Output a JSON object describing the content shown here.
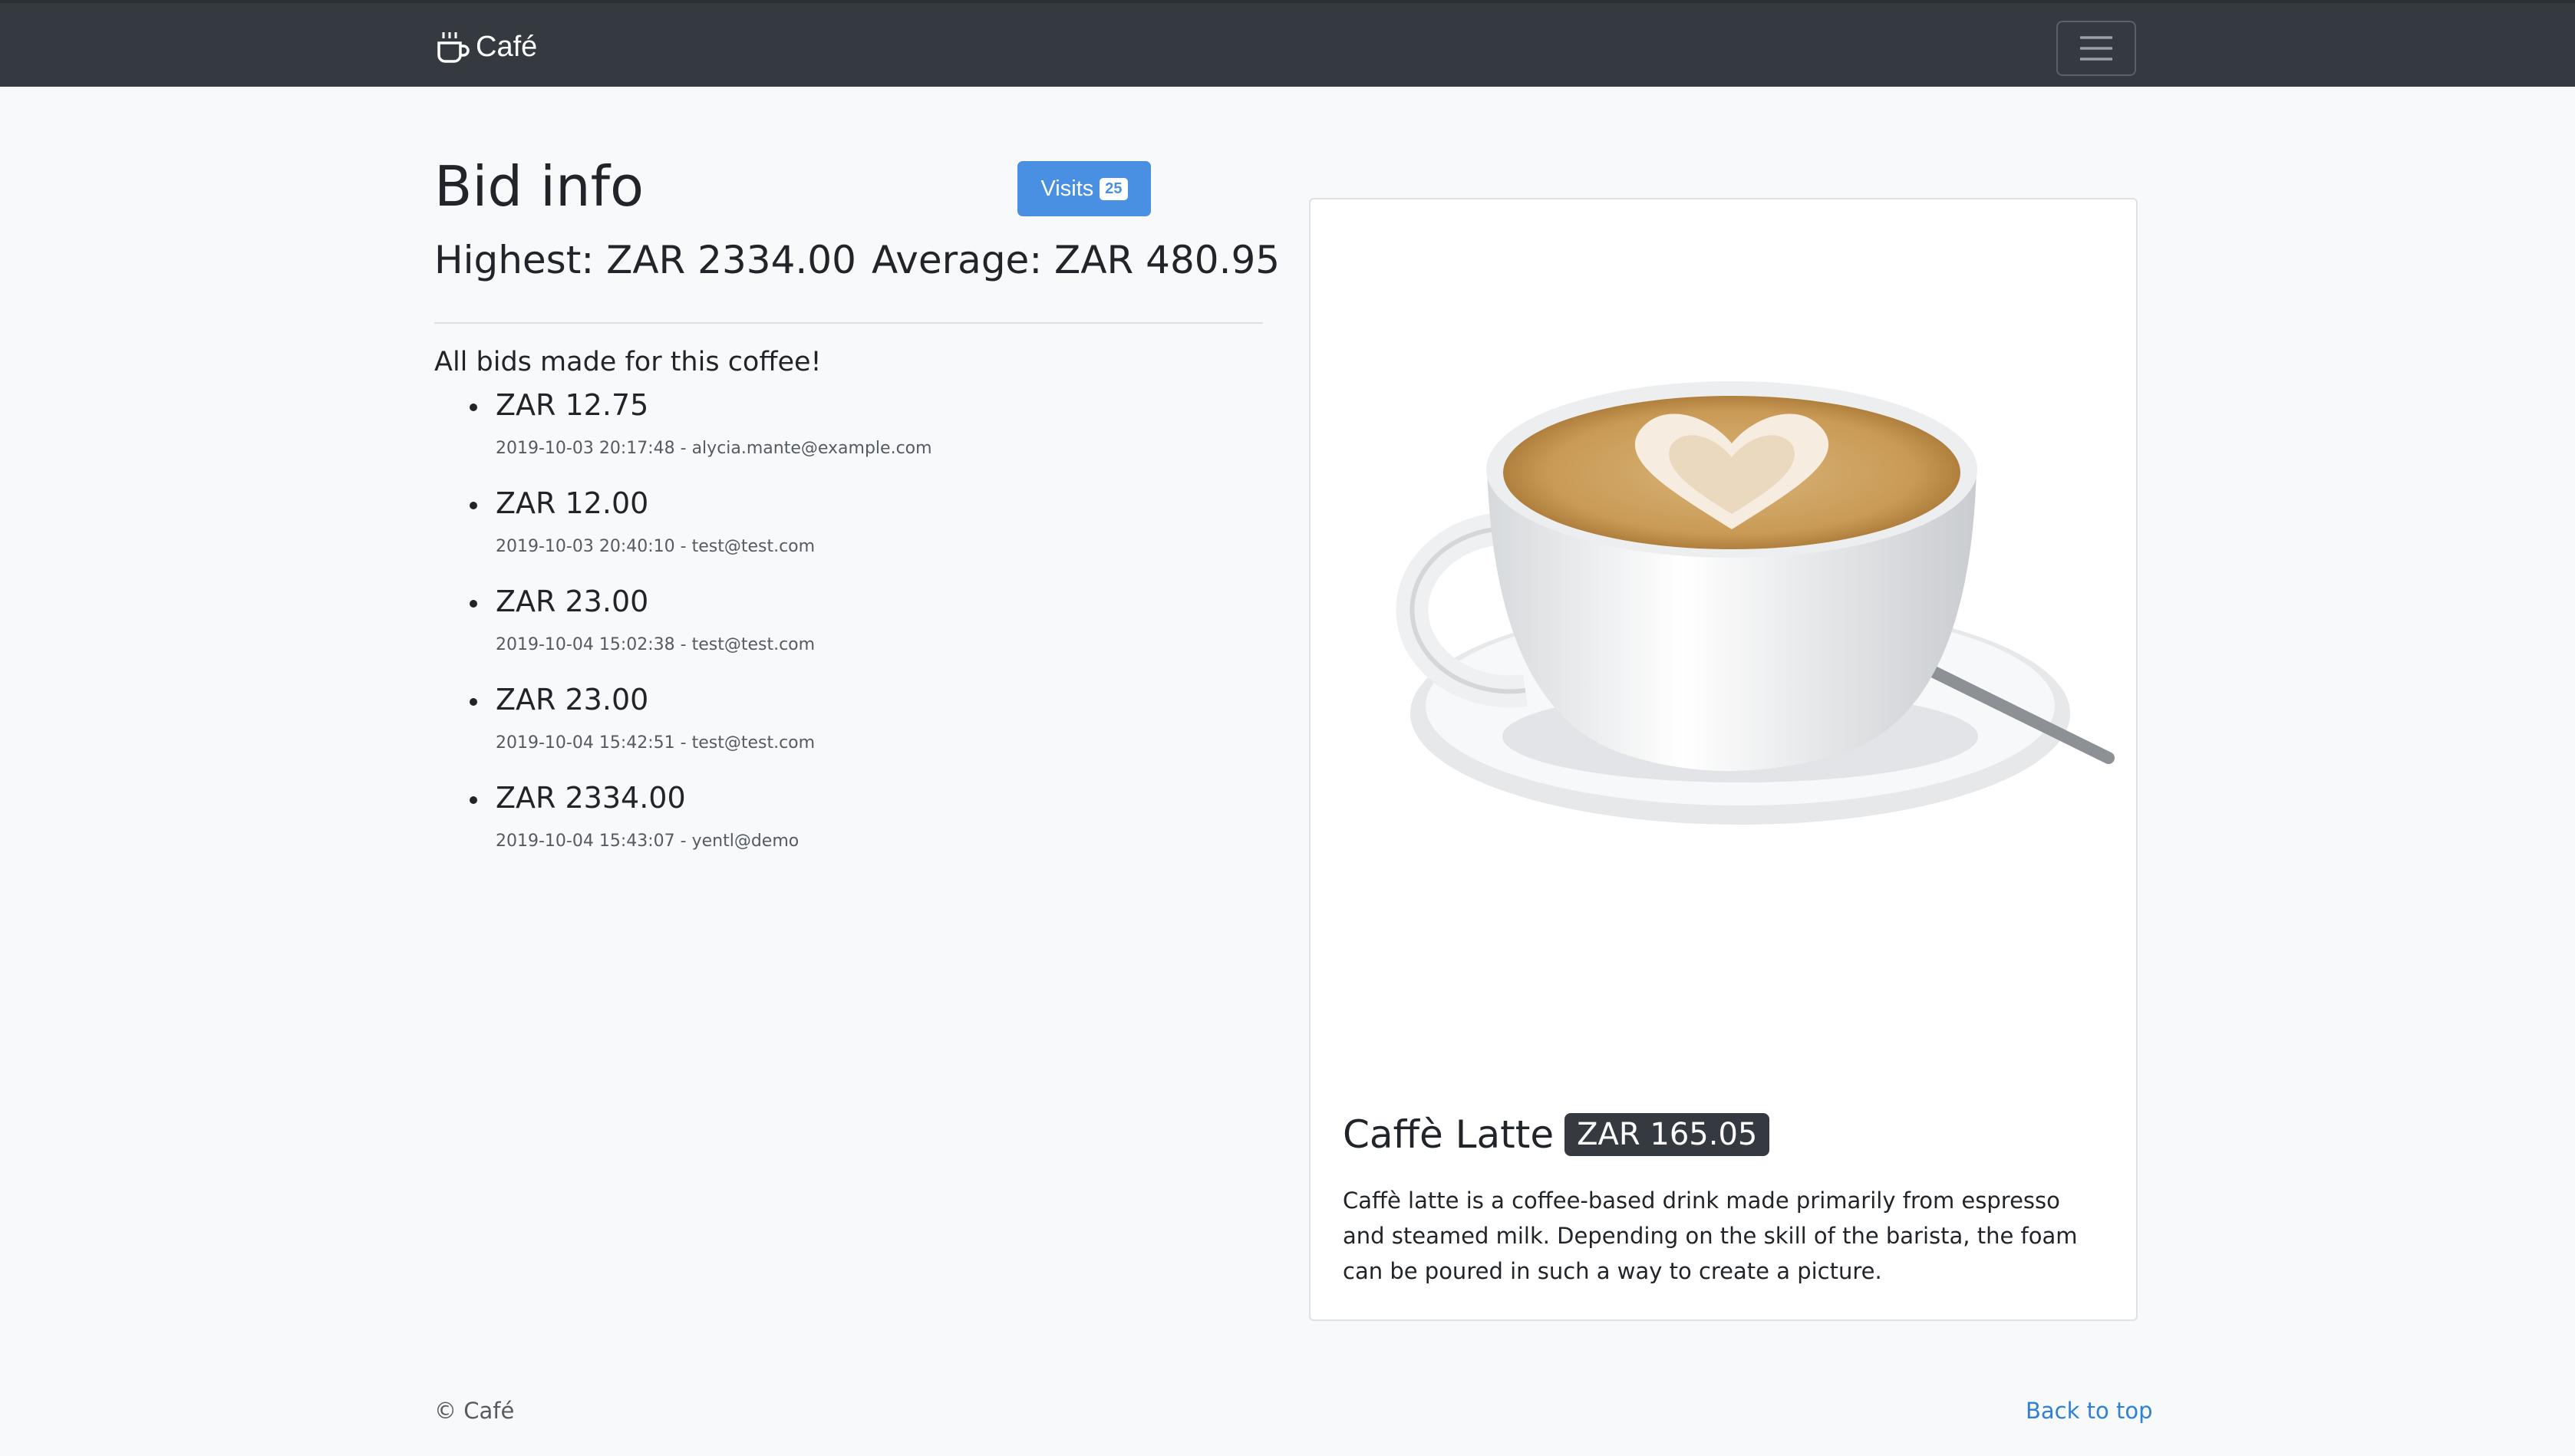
{
  "navbar": {
    "brand_label": "Café",
    "brand_icon": "coffee-cup-icon",
    "toggler_icon": "hamburger-menu-icon"
  },
  "bid_info": {
    "heading": "Bid info",
    "visits_label": "Visits",
    "visits_count": "25",
    "highest": "Highest: ZAR 2334.00",
    "average": "Average: ZAR 480.95",
    "intro": "All bids made for this coffee!",
    "bids": [
      {
        "amount": "ZAR 12.75",
        "meta": "2019-10-03 20:17:48 - alycia.mante@example.com"
      },
      {
        "amount": "ZAR 12.00",
        "meta": "2019-10-03 20:40:10 - test@test.com"
      },
      {
        "amount": "ZAR 23.00",
        "meta": "2019-10-04 15:02:38 - test@test.com"
      },
      {
        "amount": "ZAR 23.00",
        "meta": "2019-10-04 15:42:51 - test@test.com"
      },
      {
        "amount": "ZAR 2334.00",
        "meta": "2019-10-04 15:43:07 - yentl@demo"
      }
    ]
  },
  "product": {
    "name": "Caffè Latte",
    "price": "ZAR 165.05",
    "description": "Caffè latte is a coffee-based drink made primarily from espresso and steamed milk. Depending on the skill of the barista, the foam can be poured in such a way to create a picture.",
    "image_subject": "latte-cup-with-heart-latte-art"
  },
  "footer": {
    "copyright": "© Café",
    "back_to_top": "Back to top"
  },
  "colors": {
    "navbar": "#343a40",
    "page_bg": "#f8f9fa",
    "primary": "#4a90e2",
    "link": "#2f80d6",
    "badge_dark": "#343a40"
  }
}
